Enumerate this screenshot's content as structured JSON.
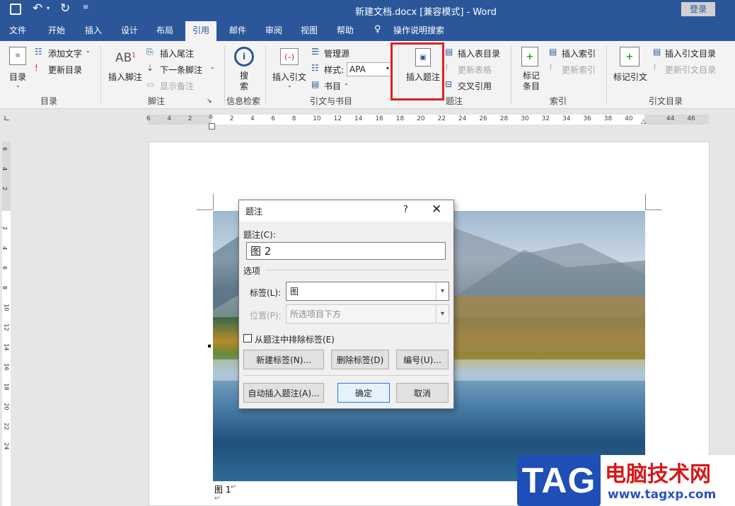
{
  "window": {
    "title": "新建文档.docx [兼容模式] - Word",
    "login": "登录"
  },
  "tabs": [
    "文件",
    "开始",
    "插入",
    "设计",
    "布局",
    "引用",
    "邮件",
    "审阅",
    "视图",
    "帮助"
  ],
  "active_tab": "引用",
  "tell_me": "操作说明搜索",
  "ribbon": {
    "toc": {
      "toc_label": "目录",
      "add_text": "添加文字",
      "update_toc": "更新目录",
      "group": "目录"
    },
    "footnote": {
      "insert_footnote": "插入脚注",
      "insert_endnote": "插入尾注",
      "next_footnote": "下一条脚注",
      "show_notes": "显示备注",
      "group": "脚注"
    },
    "research": {
      "search": "搜索",
      "group": "信息检索"
    },
    "citations": {
      "insert_citation": "插入引文",
      "manage_sources": "管理源",
      "style_label": "样式:",
      "style_value": "APA",
      "bibliography": "书目",
      "group": "引文与书目"
    },
    "captions": {
      "insert_caption": "插入题注",
      "insert_table_of_figures": "插入表目录",
      "update_table": "更新表格",
      "cross_reference": "交叉引用",
      "group": "题注"
    },
    "index": {
      "mark_entry": "标记条目",
      "insert_index": "插入索引",
      "update_index": "更新索引",
      "group": "索引"
    },
    "authorities": {
      "mark_citation": "标记引文",
      "insert_toa": "插入引文目录",
      "update_toa": "更新引文目录",
      "group": "引文目录"
    }
  },
  "ruler": {
    "ticks": [
      "6",
      "4",
      "2",
      "",
      "2",
      "4",
      "6",
      "8",
      "10",
      "12",
      "14",
      "16",
      "18",
      "20",
      "22",
      "24",
      "26",
      "28",
      "30",
      "32",
      "34",
      "36",
      "38",
      "40",
      "",
      "44",
      "46"
    ]
  },
  "vruler": {
    "ticks": [
      "6",
      "4",
      "2",
      "2",
      "4",
      "6",
      "8",
      "10",
      "12",
      "14",
      "16",
      "18",
      "20",
      "22",
      "24"
    ]
  },
  "document": {
    "caption_text": "图 1"
  },
  "dialog": {
    "title": "题注",
    "help": "?",
    "caption_label": "题注(C):",
    "caption_value": "图 2",
    "options_label": "选项",
    "label_label": "标签(L):",
    "label_value": "图",
    "position_label": "位置(P):",
    "position_value": "所选项目下方",
    "exclude_label": "从题注中排除标签(E)",
    "new_label_btn": "新建标签(N)...",
    "delete_label_btn": "删除标签(D)",
    "numbering_btn": "编号(U)...",
    "autocaption_btn": "自动插入题注(A)...",
    "ok_btn": "确定",
    "cancel_btn": "取消"
  },
  "watermark": {
    "tag": "TAG",
    "site_name": "电脑技术网",
    "url": "www.tagxp.com"
  },
  "colors": {
    "accent": "#2b579a",
    "highlight": "#e02020"
  }
}
